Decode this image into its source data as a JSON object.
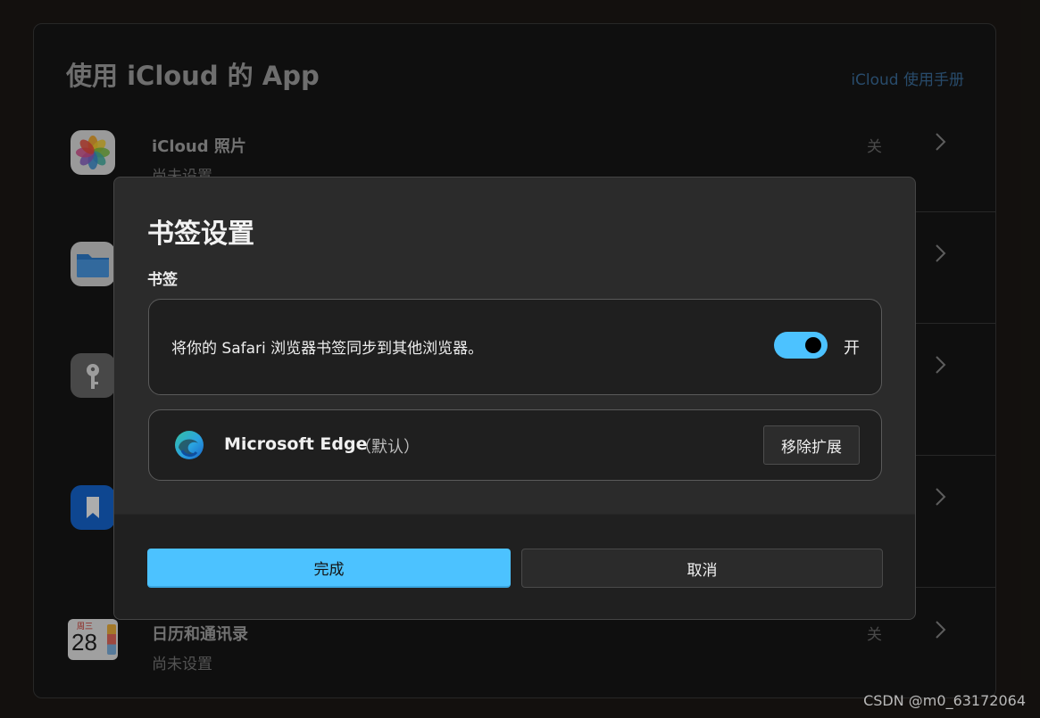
{
  "panel": {
    "title": "使用 iCloud 的 App",
    "help_link": "iCloud 使用手册",
    "apps": [
      {
        "name": "iCloud 照片",
        "subtitle": "尚未设置",
        "status": "关",
        "icon": "photos-icon"
      },
      {
        "name": "",
        "subtitle": "",
        "status": "",
        "icon": "folder-icon"
      },
      {
        "name": "",
        "subtitle": "",
        "status": "",
        "icon": "key-icon"
      },
      {
        "name": "",
        "subtitle": "",
        "status": "",
        "icon": "bookmark-icon"
      },
      {
        "name": "日历和通讯录",
        "subtitle": "尚未设置",
        "status": "关",
        "icon": "calendar-icon"
      }
    ],
    "calendar_icon": {
      "weekday": "周三",
      "day": "28"
    }
  },
  "dialog": {
    "title": "书签设置",
    "section_label": "书签",
    "sync_text": "将你的 Safari 浏览器书签同步到其他浏览器。",
    "toggle_state": "开",
    "toggle_on": true,
    "browser": {
      "name": "Microsoft Edge",
      "default_label": "（默认）",
      "remove_button": "移除扩展"
    },
    "done_button": "完成",
    "cancel_button": "取消"
  },
  "watermark": "CSDN @m0_63172064",
  "colors": {
    "accent": "#4cc2ff",
    "dialog_bg": "#2b2b2b",
    "panel_bg": "#171717",
    "link": "#3c6f9e"
  }
}
